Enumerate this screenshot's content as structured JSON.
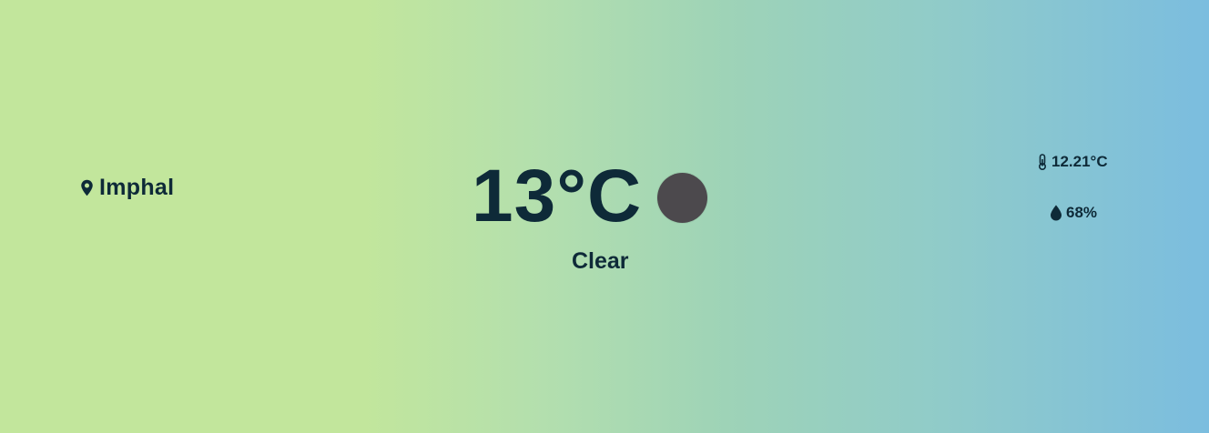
{
  "location": {
    "icon": "map-pin-icon",
    "city": "Imphal"
  },
  "current": {
    "temperature": "13°C",
    "condition": "Clear",
    "icon": "weather-condition-icon",
    "icon_color": "#4c494d"
  },
  "details": {
    "feels_like": {
      "icon": "thermometer-icon",
      "value": "12.21°C"
    },
    "humidity": {
      "icon": "droplet-icon",
      "value": "68%"
    }
  },
  "colors": {
    "text": "#0e2a38",
    "gradient_start": "#c2e69c",
    "gradient_end": "#7bbddf"
  }
}
